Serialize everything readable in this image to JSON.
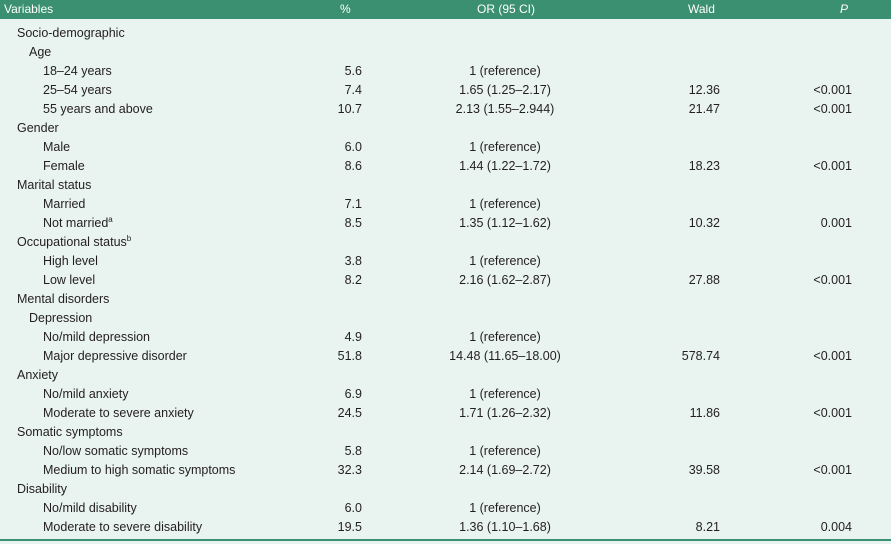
{
  "header": {
    "variables": "Variables",
    "percent": "%",
    "or": "OR (95 CI)",
    "wald": "Wald",
    "p": "P"
  },
  "rows": [
    {
      "label": "Socio-demographic",
      "level": 0
    },
    {
      "label": "Age",
      "level": 1
    },
    {
      "label": "18–24 years",
      "level": 2,
      "pct": "5.6",
      "or": "1 (reference)"
    },
    {
      "label": "25–54 years",
      "level": 2,
      "pct": "7.4",
      "or": "1.65 (1.25–2.17)",
      "wald": "12.36",
      "p": "<0.001"
    },
    {
      "label": "55 years and above",
      "level": 2,
      "pct": "10.7",
      "or": "2.13 (1.55–2.944)",
      "wald": "21.47",
      "p": "<0.001"
    },
    {
      "label": "Gender",
      "level": 0
    },
    {
      "label": "Male",
      "level": 2,
      "pct": "6.0",
      "or": "1 (reference)"
    },
    {
      "label": "Female",
      "level": 2,
      "pct": "8.6",
      "or": "1.44 (1.22–1.72)",
      "wald": "18.23",
      "p": "<0.001"
    },
    {
      "label": "Marital status",
      "level": 0
    },
    {
      "label": "Married",
      "level": 2,
      "pct": "7.1",
      "or": "1 (reference)"
    },
    {
      "label": "Not married",
      "sup": "a",
      "level": 2,
      "pct": "8.5",
      "or": "1.35 (1.12–1.62)",
      "wald": "10.32",
      "p": "0.001"
    },
    {
      "label": "Occupational status",
      "sup": "b",
      "level": 0
    },
    {
      "label": "High level",
      "level": 2,
      "pct": "3.8",
      "or": "1 (reference)"
    },
    {
      "label": "Low level",
      "level": 2,
      "pct": "8.2",
      "or": "2.16 (1.62–2.87)",
      "wald": "27.88",
      "p": "<0.001"
    },
    {
      "label": "Mental disorders",
      "level": 0
    },
    {
      "label": "Depression",
      "level": 1
    },
    {
      "label": "No/mild depression",
      "level": 2,
      "pct": "4.9",
      "or": "1 (reference)"
    },
    {
      "label": "Major depressive disorder",
      "level": 2,
      "pct": "51.8",
      "or": "14.48 (11.65–18.00)",
      "wald": "578.74",
      "p": "<0.001"
    },
    {
      "label": "Anxiety",
      "level": 0
    },
    {
      "label": "No/mild anxiety",
      "level": 2,
      "pct": "6.9",
      "or": "1 (reference)"
    },
    {
      "label": "Moderate to severe anxiety",
      "level": 2,
      "pct": "24.5",
      "or": "1.71 (1.26–2.32)",
      "wald": "11.86",
      "p": "<0.001"
    },
    {
      "label": "Somatic symptoms",
      "level": 0
    },
    {
      "label": "No/low somatic symptoms",
      "level": 2,
      "pct": "5.8",
      "or": "1 (reference)"
    },
    {
      "label": "Medium to high somatic symptoms",
      "level": 2,
      "pct": "32.3",
      "or": "2.14 (1.69–2.72)",
      "wald": "39.58",
      "p": "<0.001"
    },
    {
      "label": "Disability",
      "level": 0
    },
    {
      "label": "No/mild disability",
      "level": 2,
      "pct": "6.0",
      "or": "1 (reference)"
    },
    {
      "label": "Moderate to severe disability",
      "level": 2,
      "pct": "19.5",
      "or": "1.36 (1.10–1.68)",
      "wald": "8.21",
      "p": "0.004"
    }
  ]
}
